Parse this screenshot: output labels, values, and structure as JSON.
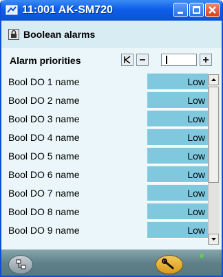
{
  "window": {
    "title": "11:001 AK-SM720"
  },
  "header": {
    "title": "Boolean alarms"
  },
  "table": {
    "column_label": "Alarm priorities",
    "rows": [
      {
        "name": "Bool DO 1 name",
        "value": "Low"
      },
      {
        "name": "Bool DO 2 name",
        "value": "Low"
      },
      {
        "name": "Bool DO 3 name",
        "value": "Low"
      },
      {
        "name": "Bool DO 4 name",
        "value": "Low"
      },
      {
        "name": "Bool DO 5 name",
        "value": "Low"
      },
      {
        "name": "Bool DO 6 name",
        "value": "Low"
      },
      {
        "name": "Bool DO 7 name",
        "value": "Low"
      },
      {
        "name": "Bool DO 8 name",
        "value": "Low"
      },
      {
        "name": "Bool DO 9 name",
        "value": "Low"
      }
    ]
  },
  "pager": {
    "first_icon": "first-page-icon",
    "prev_icon": "previous-icon",
    "next_icon": "next-icon"
  },
  "footer": {
    "left_icon": "network-tree-icon",
    "right_icon": "wrench-icon"
  },
  "colors": {
    "titlebar": "#0e5ee8",
    "value_cell": "#7fc8de",
    "background": "#eaf6f9",
    "led": "#5cd24a"
  }
}
